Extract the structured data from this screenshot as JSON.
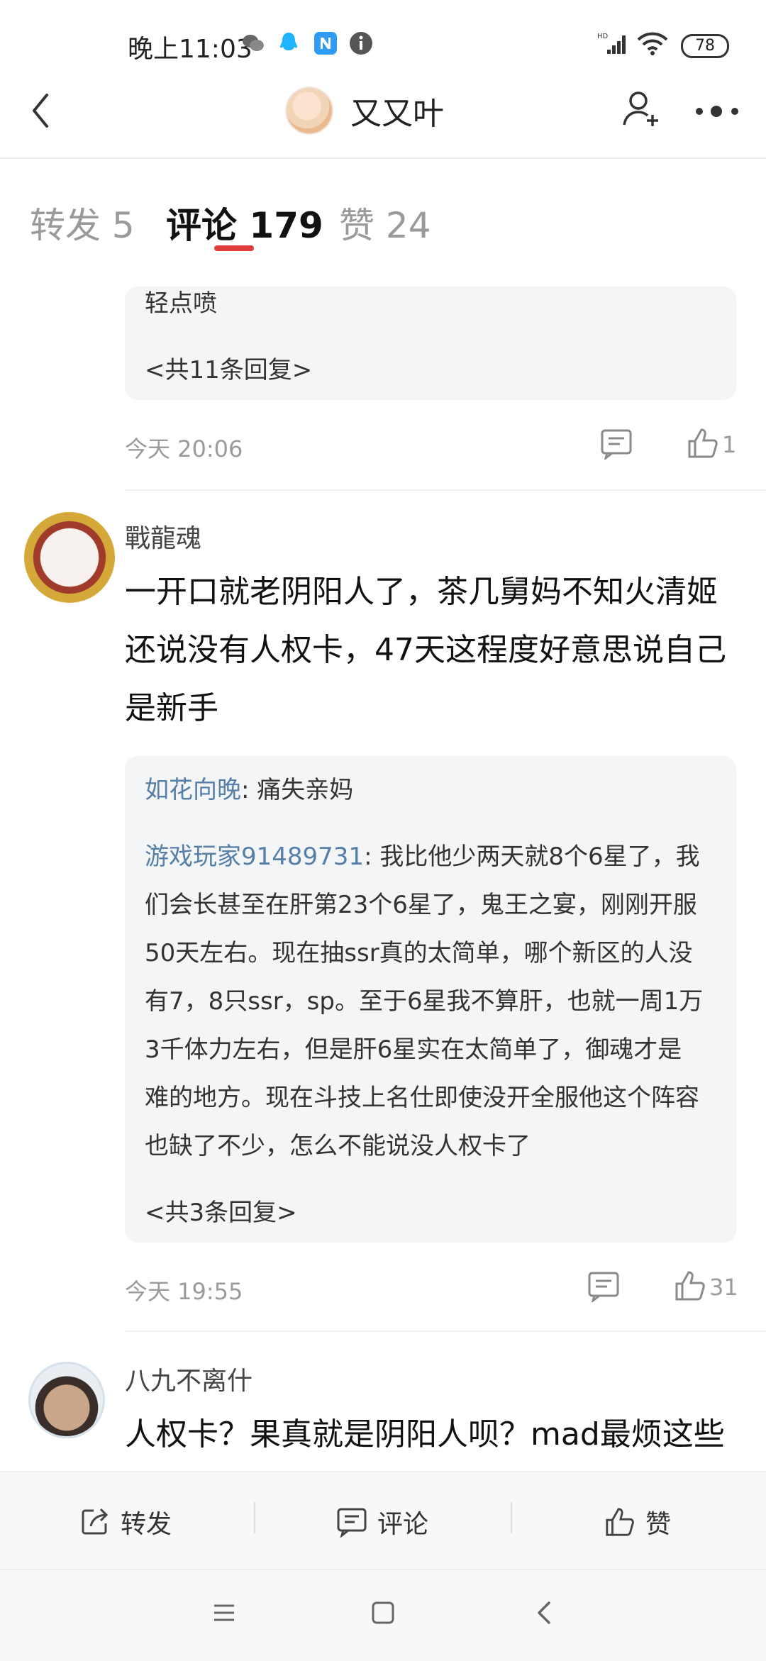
{
  "status_bar": {
    "time": "晚上11:03",
    "battery": "78",
    "icons": [
      "wechat-icon",
      "qq-icon",
      "n-app-icon",
      "info-icon",
      "hd-signal-icon",
      "wifi-icon",
      "battery-icon"
    ]
  },
  "header": {
    "title": "又又叶",
    "icons": [
      "back-icon",
      "avatar",
      "add-user-icon",
      "more-icon"
    ]
  },
  "tabs": [
    {
      "label": "转发 5"
    },
    {
      "label": "评论 179"
    },
    {
      "label": "赞 24"
    }
  ],
  "comments": [
    {
      "reply_box": {
        "text": "轻点喷",
        "more": "<共11条回复>"
      },
      "time": "今天 20:06",
      "likes": "1"
    },
    {
      "user": "戰龍魂",
      "text_lines": [
        "一开口就老阴阳人了，茶几舅妈不知火清姬",
        "还说没有人权卡，47天这程度好意思说自己",
        "是新手"
      ],
      "replies": [
        {
          "user": "如花向晚",
          "sep": ": ",
          "text": "痛失亲妈"
        },
        {
          "user": "游戏玩家91489731",
          "sep": ": ",
          "lines": [
            "我比他少两天就8个6星了，我",
            "们会长甚至在肝第23个6星了，鬼王之宴，刚刚开服",
            "50天左右。现在抽ssr真的太简单，哪个新区的人没",
            "有7，8只ssr，sp。至于6星我不算肝，也就一周1万",
            "3千体力左右，但是肝6星实在太简单了，御魂才是",
            "难的地方。现在斗技上名仕即使没开全服他这个阵容",
            "也缺了不少，怎么不能说没人权卡了"
          ]
        }
      ],
      "more": "<共3条回复>",
      "time": "今天 19:55",
      "likes": "31"
    },
    {
      "user": "八九不离什",
      "text_lines": [
        "人权卡？果真就是阴阳人呗？mad最烦这些"
      ]
    }
  ],
  "actions": [
    {
      "label": "转发",
      "icon": "share-icon"
    },
    {
      "label": "评论",
      "icon": "comment-icon"
    },
    {
      "label": "赞",
      "icon": "like-icon"
    }
  ],
  "nav": [
    "menu-icon",
    "home-icon",
    "back-nav-icon"
  ],
  "colors": {
    "accent": "#e33b3b",
    "link": "#567ea6",
    "reply_bg": "#f4f5f7"
  }
}
